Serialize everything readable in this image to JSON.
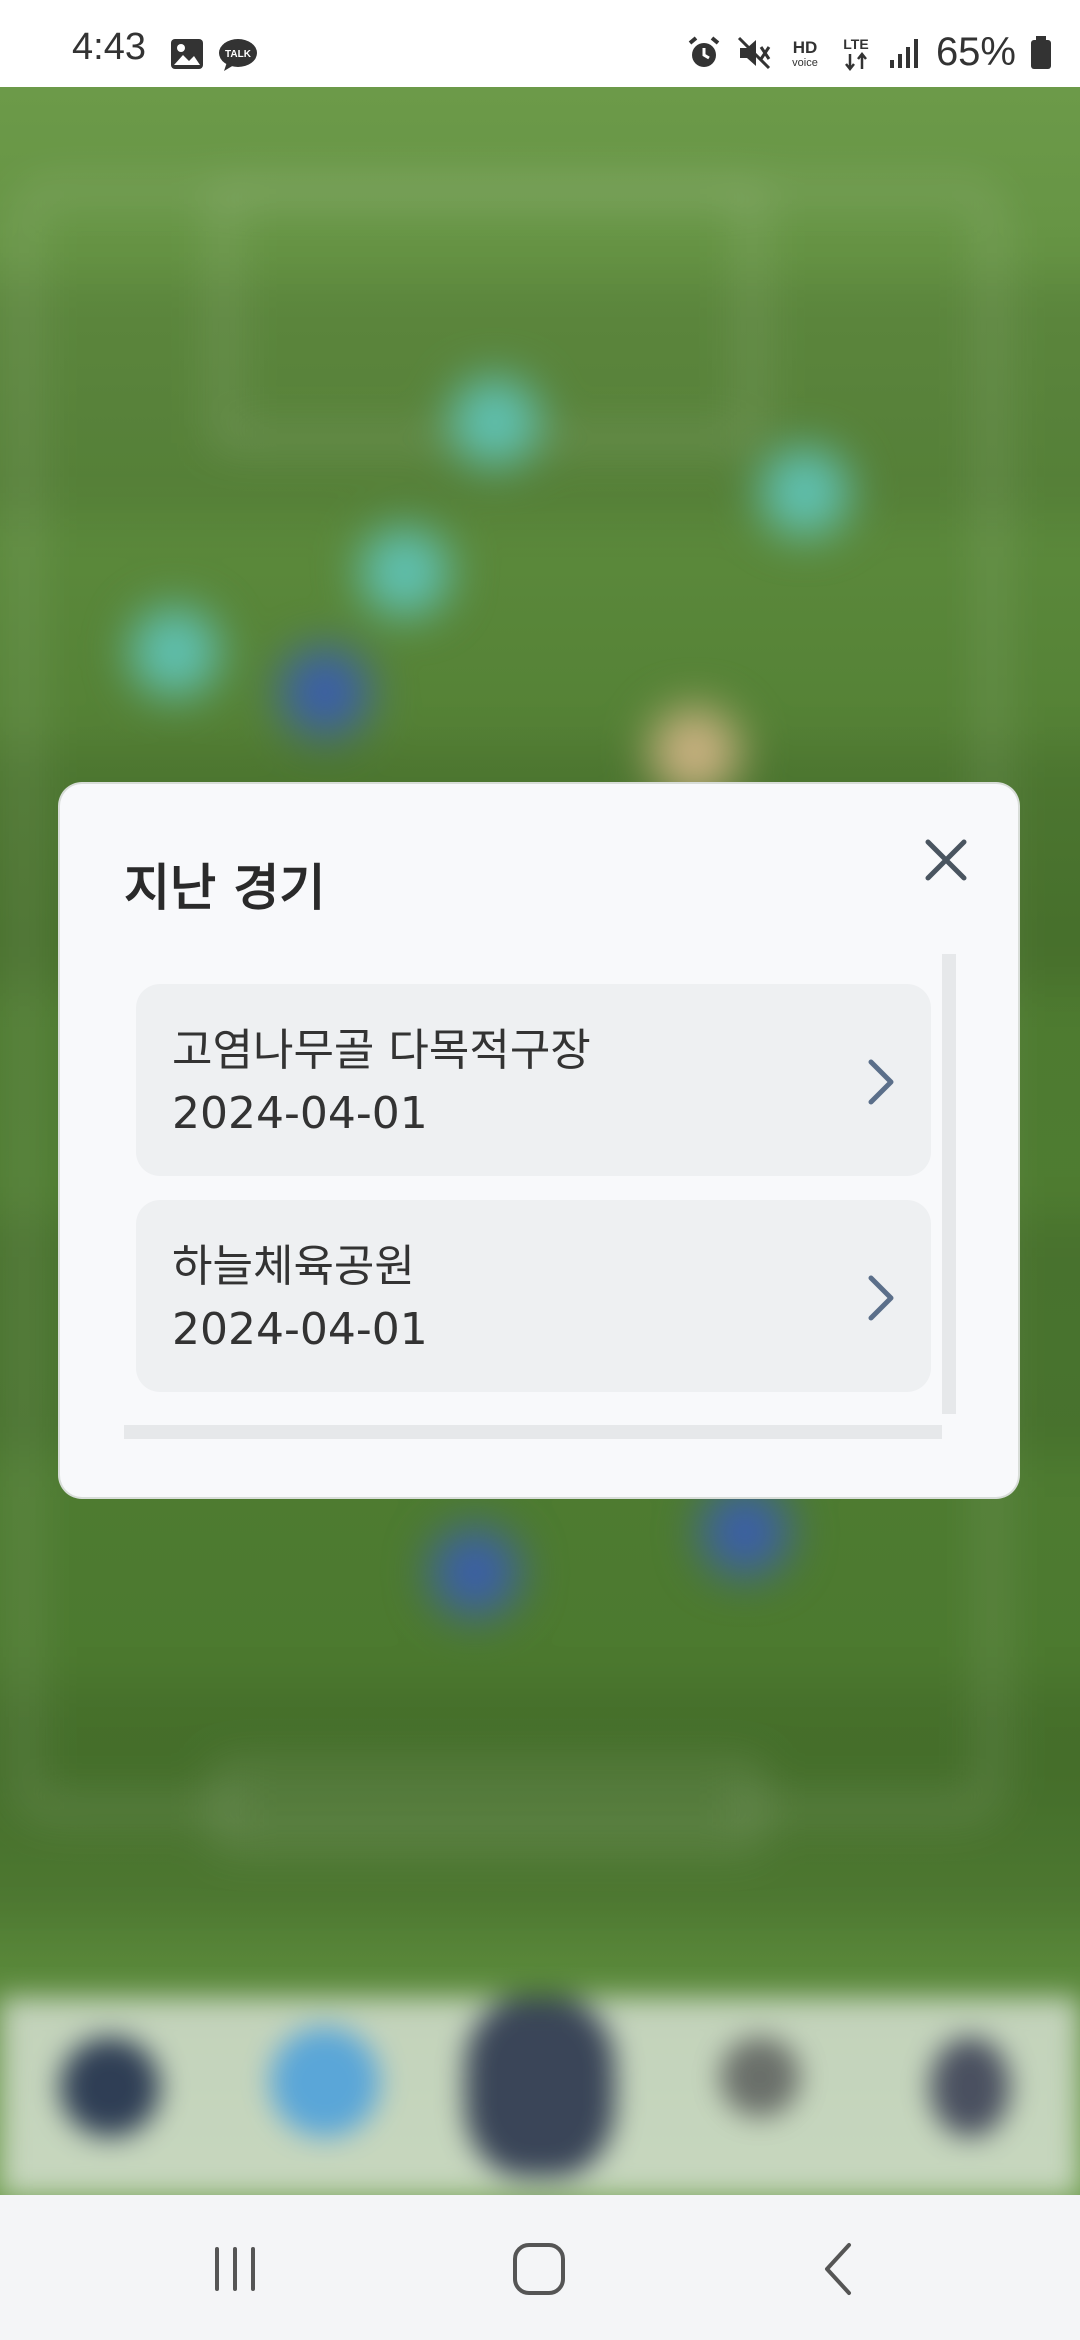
{
  "status_bar": {
    "time": "4:43",
    "battery": "65%",
    "icons": [
      "gallery-icon",
      "talk-icon",
      "alarm-icon",
      "mute-icon",
      "hd-voice-icon",
      "lte-icon",
      "signal-icon",
      "battery-icon"
    ],
    "talk_badge": "TALK",
    "hd_label": "HD",
    "voice_label": "voice",
    "lte_label": "LTE"
  },
  "modal": {
    "title": "지난 경기",
    "close_icon": "close-icon",
    "items": [
      {
        "name": "고염나무골 다목적구장",
        "date": "2024-04-01"
      },
      {
        "name": "하늘체육공원",
        "date": "2024-04-01"
      }
    ]
  },
  "system_nav": {
    "recent": "recent-apps-icon",
    "home": "home-icon",
    "back": "back-icon"
  },
  "colors": {
    "modal_bg": "#f8f9fb",
    "item_bg": "#eef0f2",
    "chevron": "#5b6f8a",
    "field_green": "#4e7a30"
  }
}
